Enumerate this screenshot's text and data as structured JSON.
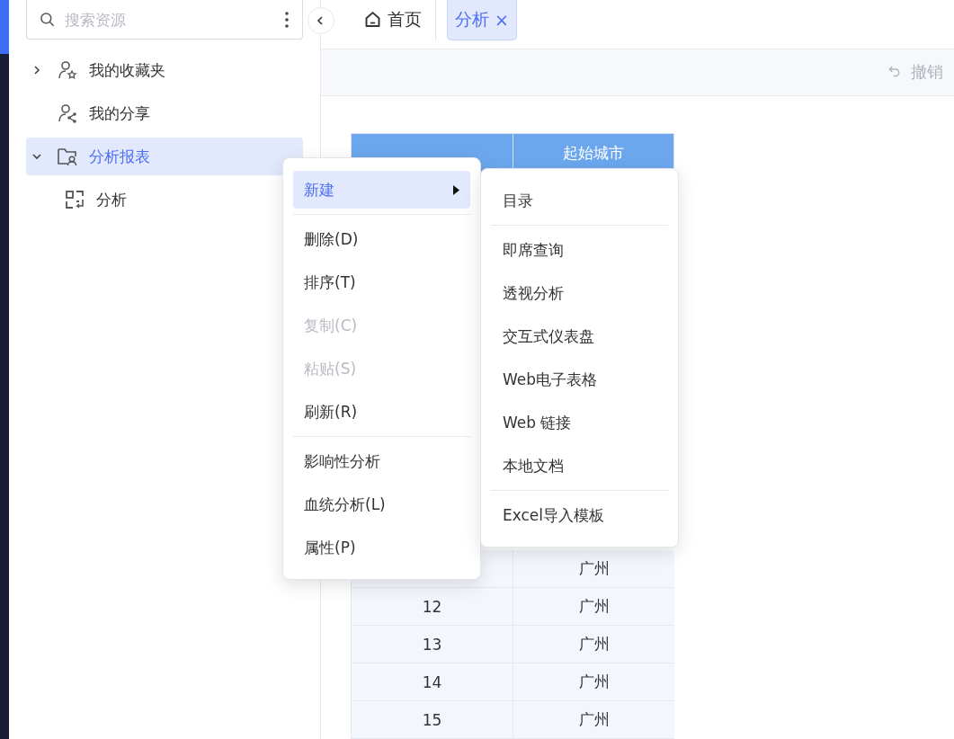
{
  "sidebar": {
    "search": {
      "placeholder": "搜索资源"
    },
    "tree": [
      {
        "label": "我的收藏夹",
        "expanded": false,
        "selected": false
      },
      {
        "label": "我的分享",
        "selected": false
      },
      {
        "label": "分析报表",
        "expanded": true,
        "selected": true,
        "children": [
          {
            "label": "分析",
            "selected": false
          }
        ]
      }
    ]
  },
  "tabs": [
    {
      "label": "首页",
      "kind": "home",
      "selected": false
    },
    {
      "label": "分析",
      "kind": "page",
      "selected": true,
      "close": "×"
    }
  ],
  "toolbar": {
    "undo": {
      "label": "撤销",
      "disabled": true
    }
  },
  "table": {
    "columns": [
      null,
      "起始城市"
    ],
    "rows": [
      [
        null,
        "广州"
      ],
      [
        "12",
        "广州"
      ],
      [
        "13",
        "广州"
      ],
      [
        "14",
        "广州"
      ],
      [
        "15",
        "广州"
      ]
    ]
  },
  "context_menu": {
    "items": [
      {
        "kind": "item",
        "label": "新建",
        "selected": true,
        "disabled": false,
        "submenu": true
      },
      {
        "kind": "separator"
      },
      {
        "kind": "item",
        "label": "删除(D)",
        "selected": false,
        "disabled": false,
        "submenu": false
      },
      {
        "kind": "item",
        "label": "排序(T)",
        "selected": false,
        "disabled": false,
        "submenu": false
      },
      {
        "kind": "item",
        "label": "复制(C)",
        "selected": false,
        "disabled": true,
        "submenu": false
      },
      {
        "kind": "item",
        "label": "粘贴(S)",
        "selected": false,
        "disabled": true,
        "submenu": false
      },
      {
        "kind": "item",
        "label": "刷新(R)",
        "selected": false,
        "disabled": false,
        "submenu": false
      },
      {
        "kind": "separator"
      },
      {
        "kind": "item",
        "label": "影响性分析",
        "selected": false,
        "disabled": false,
        "submenu": false
      },
      {
        "kind": "item",
        "label": "血统分析(L)",
        "selected": false,
        "disabled": false,
        "submenu": false
      },
      {
        "kind": "item",
        "label": "属性(P)",
        "selected": false,
        "disabled": false,
        "submenu": false
      }
    ]
  },
  "submenu": {
    "items": [
      {
        "kind": "item",
        "label": "目录"
      },
      {
        "kind": "separator"
      },
      {
        "kind": "item",
        "label": "即席查询"
      },
      {
        "kind": "item",
        "label": "透视分析"
      },
      {
        "kind": "item",
        "label": "交互式仪表盘"
      },
      {
        "kind": "item",
        "label": "Web电子表格"
      },
      {
        "kind": "item",
        "label": "Web 链接"
      },
      {
        "kind": "item",
        "label": "本地文档"
      },
      {
        "kind": "separator"
      },
      {
        "kind": "item",
        "label": "Excel导入模板"
      }
    ]
  }
}
